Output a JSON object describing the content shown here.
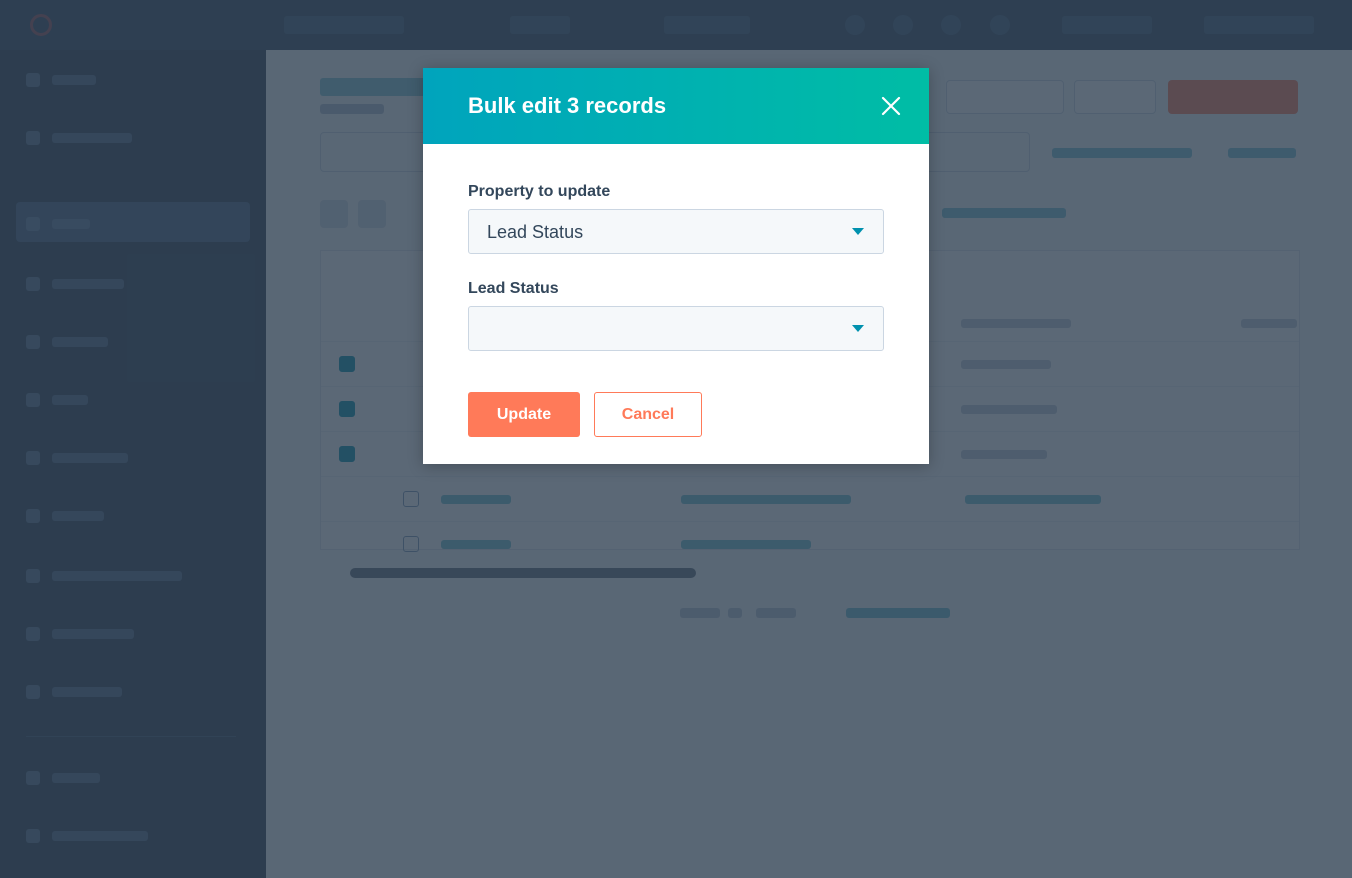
{
  "modal": {
    "title": "Bulk edit 3 records",
    "close_icon": "close-icon",
    "fields": [
      {
        "label": "Property to update",
        "value": "Lead Status"
      },
      {
        "label": "Lead Status",
        "value": ""
      }
    ],
    "update_label": "Update",
    "cancel_label": "Cancel"
  },
  "colors": {
    "header_gradient_start": "#00a4bd",
    "header_gradient_end": "#00bda5",
    "primary_button": "#ff7a59",
    "caret": "#0091ae",
    "overlay": "#2d3e50"
  },
  "background": {
    "table_rows_selected": [
      true,
      true,
      true,
      false,
      false
    ]
  }
}
